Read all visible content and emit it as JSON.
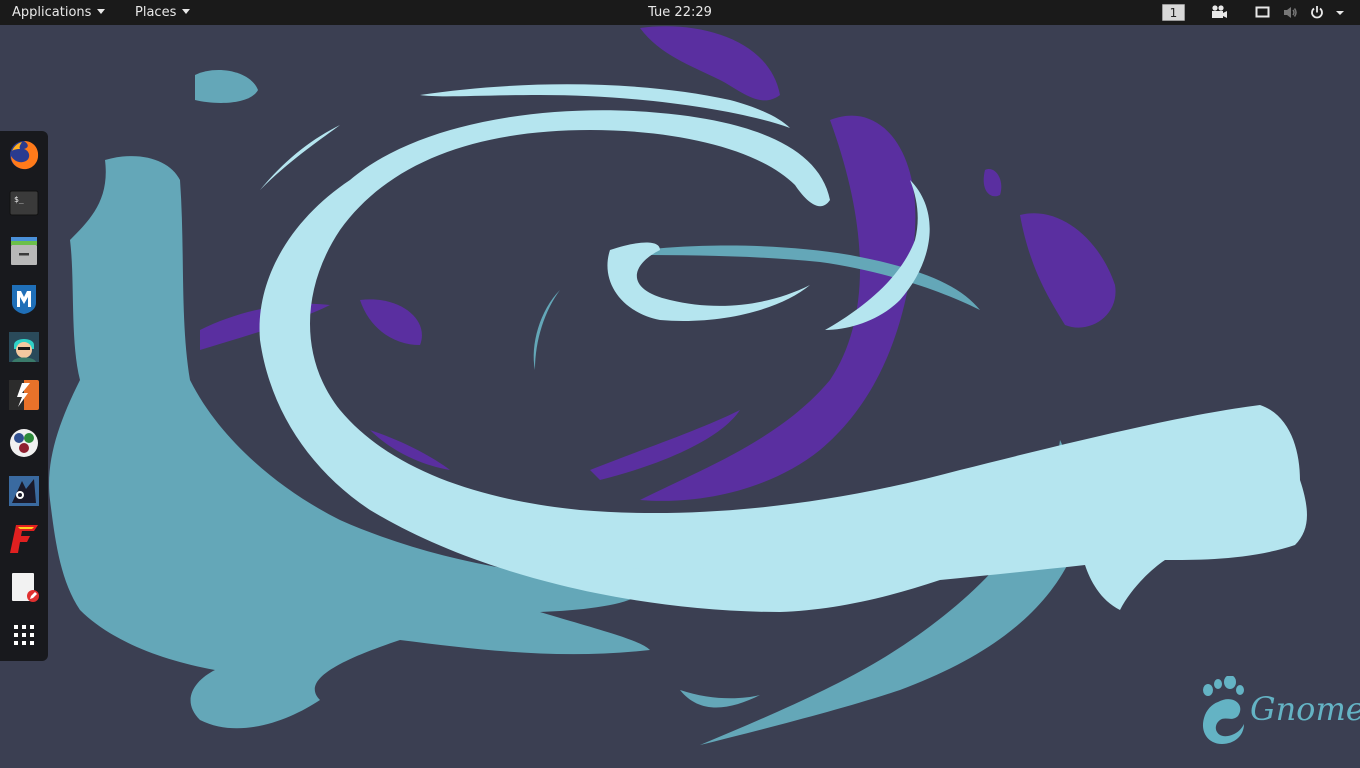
{
  "topbar": {
    "applications_label": "Applications",
    "places_label": "Places",
    "clock": "Tue 22:29",
    "workspace_number": "1"
  },
  "dock": {
    "items": [
      {
        "name": "firefox",
        "icon": "firefox-icon"
      },
      {
        "name": "terminal",
        "icon": "terminal-icon"
      },
      {
        "name": "files",
        "icon": "files-icon"
      },
      {
        "name": "metasploit",
        "icon": "metasploit-icon"
      },
      {
        "name": "armitage",
        "icon": "armitage-icon"
      },
      {
        "name": "burpsuite",
        "icon": "burpsuite-icon"
      },
      {
        "name": "maltego",
        "icon": "maltego-icon"
      },
      {
        "name": "beef",
        "icon": "beef-icon"
      },
      {
        "name": "faraday",
        "icon": "faraday-icon"
      },
      {
        "name": "leafpad",
        "icon": "text-editor-icon"
      },
      {
        "name": "show-applications",
        "icon": "app-grid-icon"
      }
    ]
  },
  "wallpaper": {
    "logo_text": "Gnome",
    "colors": {
      "background": "#3b3f52",
      "light_cyan": "#b5e5ef",
      "teal": "#64a7b8",
      "purple": "#5a2fa0"
    }
  }
}
